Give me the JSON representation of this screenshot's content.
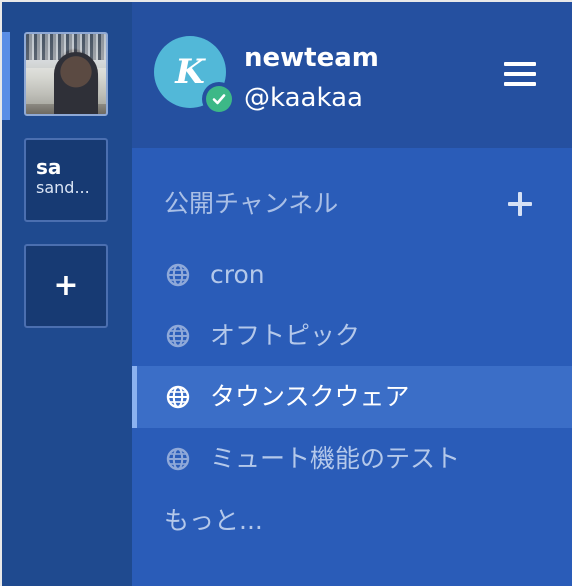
{
  "team_sidebar": {
    "teams": [
      {
        "kind": "photo"
      },
      {
        "initials": "sa",
        "name": "sand..."
      }
    ],
    "add_team_label": "+"
  },
  "header": {
    "avatar_letter": "K",
    "team_name": "newteam",
    "username": "@kaakaa",
    "status": "online"
  },
  "channels": {
    "section_title": "公開チャンネル",
    "items": [
      {
        "label": "cron",
        "icon": "globe-icon",
        "active": false
      },
      {
        "label": "オフトピック",
        "icon": "globe-icon",
        "active": false
      },
      {
        "label": "タウンスクウェア",
        "icon": "globe-icon",
        "active": true
      },
      {
        "label": "ミュート機能のテスト",
        "icon": "globe-icon",
        "active": false
      }
    ],
    "more_label": "もっと..."
  },
  "colors": {
    "sidebar_bg": "#2a5cb8",
    "header_bg": "#2550a0",
    "team_sidebar_bg": "#1f4a8f",
    "active_channel_bg": "#3b6ec7",
    "avatar_bg": "#52b8d8",
    "status_online": "#3db887"
  }
}
